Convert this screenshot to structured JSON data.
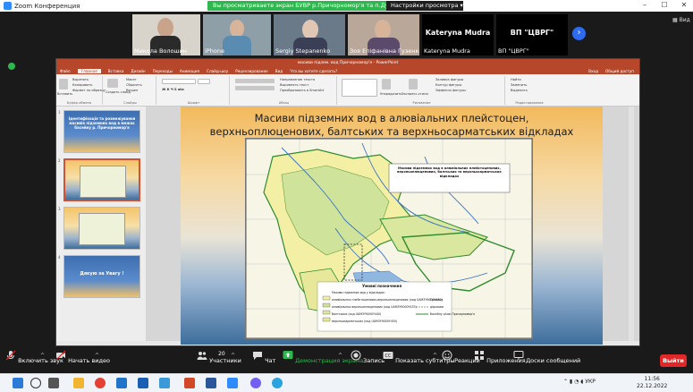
{
  "window": {
    "app_title": "Zoom Конференция",
    "share_banner": "Вы просматриваете экран БУВР р.Причорномор'я та п.Дуна...",
    "view_options": "Настройки просмотра",
    "view_label": "Вид",
    "win_controls": [
      "–",
      "☐",
      "✕"
    ]
  },
  "participants": [
    {
      "name": "Микола Волошин",
      "type": "video"
    },
    {
      "name": "iPhone",
      "type": "video"
    },
    {
      "name": "Sergiy Stepanenko",
      "type": "video"
    },
    {
      "name": "Зоя Епіфанівна Гузенко",
      "type": "video"
    },
    {
      "name": "Kateryna Mudra",
      "bigname": "Kateryna Mudra",
      "type": "name"
    },
    {
      "name": "ВП \"ЦВРГ\"",
      "bigname": "ВП \"ЦВРГ\"",
      "type": "name"
    }
  ],
  "ppt": {
    "title": "масиви підзем. вод Причорномор'я - PowerPoint",
    "tabs": [
      "Файл",
      "Главная",
      "Вставка",
      "Дизайн",
      "Переходы",
      "Анимация",
      "Слайд-шоу",
      "Рецензирование",
      "Вид",
      "Что вы хотите сделать?"
    ],
    "tabs_right": [
      "Вход",
      "Общий доступ"
    ],
    "ribbon": {
      "paste": "Вставить",
      "cut": "Вырезать",
      "copy": "Копировать",
      "format_painter": "Формат по образцу",
      "clipboard": "Буфер обмена",
      "new_slide": "Создать слайд",
      "layout": "Макет",
      "reset": "Сбросить",
      "section": "Раздел",
      "slides": "Слайды",
      "font": "Шрифт",
      "paragraph": "Абзац",
      "text_direction": "Направление текста",
      "align_text": "Выровнять текст",
      "smartart": "Преобразовать в SmartArt",
      "drawing": "Рисование",
      "arrange": "Упорядочить",
      "quick_styles": "Экспресс-стили",
      "shape_fill": "Заливка фигуры",
      "shape_outline": "Контур фигуры",
      "shape_effects": "Эффекты фигуры",
      "find": "Найти",
      "replace": "Заменить",
      "select": "Выделить",
      "editing": "Редактирование"
    },
    "thumbnails": [
      {
        "num": "1",
        "text": "Ідентифікація та розмежування масивів підземних вод в межах басейну р. Причорномор'я"
      },
      {
        "num": "2",
        "text": ""
      },
      {
        "num": "3",
        "text": ""
      },
      {
        "num": "4",
        "text": "Дякую за Увагу !"
      }
    ],
    "slide": {
      "title_line1": "Масиви підземних вод в алювіальних плейстоцен,",
      "title_line2": "верхньоплюценових, балтських та верхньосарматських відкладах",
      "map_legend_title": "Масиви підземних вод в алювіальних плейстоценових, верхньоплюценових, балтських та верхньосарматських відкладах",
      "legend_heading": "Умовні позначення",
      "legend_items": [
        "Масиви підземних вод у відкладах:",
        "алювіальних плейстоценових-верхньоплюценових (код UAM3Y9000Y430)",
        "алювіальних верхньоплюценових (код UAM3Y9000Y433)",
        "балтських (код UAM3Y9000Y440)",
        "верхньосарматських (код UAM3Y9000Y450)"
      ],
      "legend_right": [
        "Границя",
        "держави",
        "басейну річок Причорномор'я"
      ]
    }
  },
  "toolbar": {
    "items": [
      {
        "label": "Включить звук",
        "icon": "microphone-muted-icon"
      },
      {
        "label": "Начать видео",
        "icon": "camera-off-icon"
      },
      {
        "label": "Участники",
        "icon": "participants-icon",
        "badge": "20"
      },
      {
        "label": "Чат",
        "icon": "chat-icon"
      },
      {
        "label": "Демонстрация экрана",
        "icon": "share-screen-icon"
      },
      {
        "label": "Запись",
        "icon": "record-icon"
      },
      {
        "label": "Показать субтитры",
        "icon": "cc-icon"
      },
      {
        "label": "Реакции",
        "icon": "reaction-icon"
      },
      {
        "label": "Приложения",
        "icon": "apps-icon"
      },
      {
        "label": "Доски сообщений",
        "icon": "whiteboard-icon"
      }
    ],
    "leave": "Выйти",
    "colors": {
      "share": "#2db84d",
      "leave": "#e02828"
    }
  },
  "taskbar": {
    "tray_lang": "УКР",
    "time": "11:56",
    "date": "22.12.2022"
  }
}
